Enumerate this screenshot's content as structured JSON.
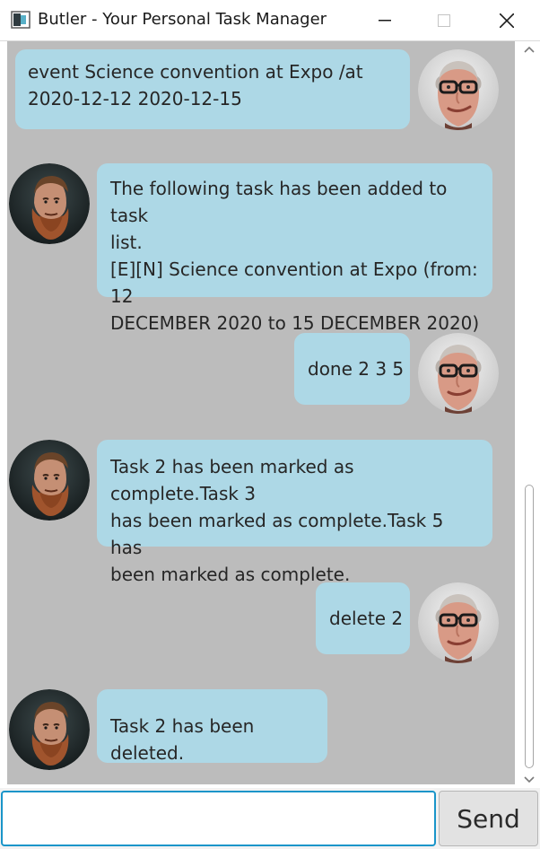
{
  "window": {
    "title": "Butler - Your Personal Task Manager"
  },
  "messages": [
    {
      "sender": "user",
      "lines": [
        "event Science convention at Expo /at",
        "2020-12-12 2020-12-15"
      ]
    },
    {
      "sender": "butler",
      "lines": [
        "The following task has been added to task",
        "list.",
        "[E][N] Science convention at Expo (from: 12",
        "DECEMBER 2020 to 15 DECEMBER 2020)"
      ]
    },
    {
      "sender": "user",
      "lines": [
        "done 2 3 5"
      ]
    },
    {
      "sender": "butler",
      "lines": [
        "Task 2 has been marked as complete.Task 3",
        "has been marked as complete.Task 5 has",
        "been marked as complete."
      ]
    },
    {
      "sender": "user",
      "lines": [
        "delete 2"
      ]
    },
    {
      "sender": "butler",
      "lines": [
        "Task 2 has been deleted."
      ]
    }
  ],
  "input": {
    "value": "",
    "placeholder": ""
  },
  "send_button": {
    "label": "Send"
  },
  "colors": {
    "chat_background": "#bcbcbc",
    "bubble": "#add8e6",
    "input_focus_border": "#1a95c9"
  },
  "icons": {
    "app": "window-app-icon",
    "minimize": "minimize-icon",
    "maximize": "maximize-icon",
    "close": "close-icon"
  }
}
